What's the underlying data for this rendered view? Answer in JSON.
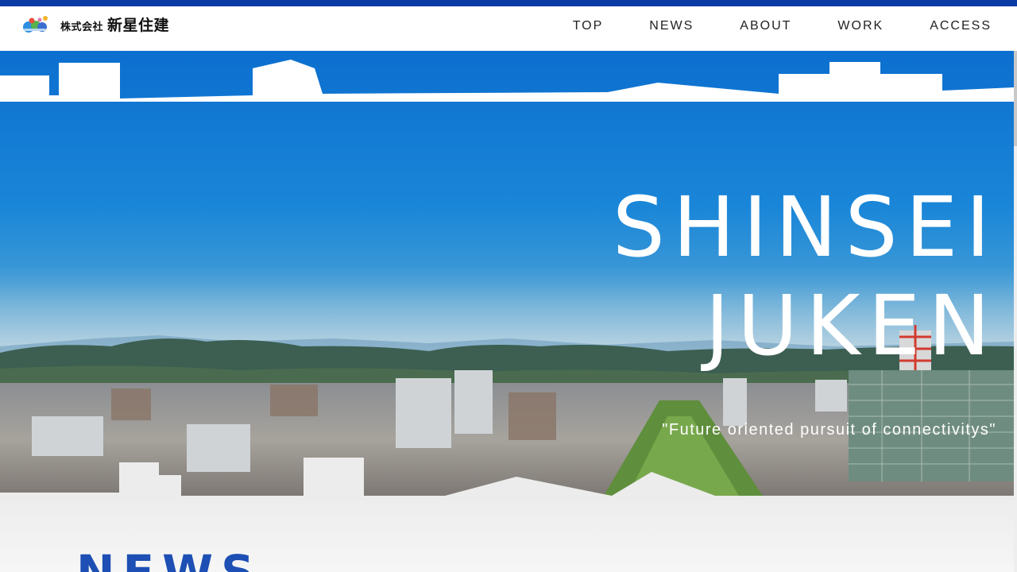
{
  "header": {
    "logo_prefix": "株式会社",
    "logo_name": "新星住建",
    "nav": [
      {
        "label": "TOP"
      },
      {
        "label": "NEWS"
      },
      {
        "label": "ABOUT"
      },
      {
        "label": "WORK"
      },
      {
        "label": "ACCESS"
      }
    ]
  },
  "hero": {
    "title_line1": "SHINSEI",
    "title_line2": "JUKEN",
    "tagline": "\"Future oriented pursuit of connectivitys\""
  },
  "news": {
    "heading": "NEWS"
  },
  "colors": {
    "brand_blue": "#0a3aa3",
    "sky_blue": "#1a86d8",
    "heading_blue": "#1d4fb4"
  }
}
